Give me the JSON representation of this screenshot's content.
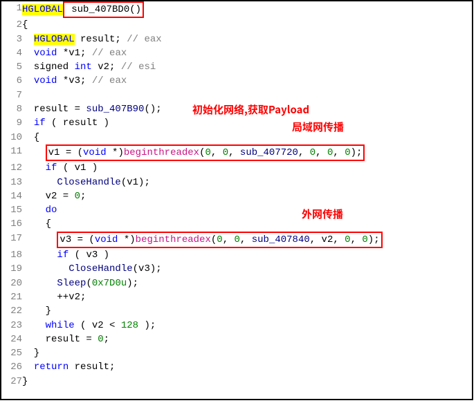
{
  "annotations": {
    "a1": "初始化网络,获取Payload",
    "a2": "局域网传播",
    "a3": "外网传播"
  },
  "lines": {
    "l1_a": "HGLOBAL",
    "l1_b": " sub_407BD0()",
    "l2": "{",
    "l3_a": "  ",
    "l3_b": "HGLOBAL",
    "l3_c": " result; ",
    "l3_d": "// eax",
    "l4_a": "  ",
    "l4_b": "void",
    "l4_c": " *v1; ",
    "l4_d": "// eax",
    "l5_a": "  signed ",
    "l5_b": "int",
    "l5_c": " v2; ",
    "l5_d": "// esi",
    "l6_a": "  ",
    "l6_b": "void",
    "l6_c": " *v3; ",
    "l6_d": "// eax",
    "l7": "",
    "l8_a": "  result = ",
    "l8_b": "sub_407B90",
    "l8_c": "();",
    "l9_a": "  ",
    "l9_b": "if",
    "l9_c": " ( result )",
    "l10": "  {",
    "l11_pre": "    ",
    "l11_a": "v1 = (",
    "l11_b": "void",
    "l11_c": " *)",
    "l11_d": "beginthreadex",
    "l11_e": "(",
    "l11_f": "0",
    "l11_g": ", ",
    "l11_h": "0",
    "l11_i": ", ",
    "l11_j": "sub_407720",
    "l11_k": ", ",
    "l11_l": "0",
    "l11_m": ", ",
    "l11_n": "0",
    "l11_o": ", ",
    "l11_p": "0",
    "l11_q": ");",
    "l12_a": "    ",
    "l12_b": "if",
    "l12_c": " ( v1 )",
    "l13_a": "      ",
    "l13_b": "CloseHandle",
    "l13_c": "(v1);",
    "l14_a": "    v2 = ",
    "l14_b": "0",
    "l14_c": ";",
    "l15_a": "    ",
    "l15_b": "do",
    "l16": "    {",
    "l17_pre": "      ",
    "l17_a": "v3 = (",
    "l17_b": "void",
    "l17_c": " *)",
    "l17_d": "beginthreadex",
    "l17_e": "(",
    "l17_f": "0",
    "l17_g": ", ",
    "l17_h": "0",
    "l17_i": ", ",
    "l17_j": "sub_407840",
    "l17_k": ", v2, ",
    "l17_l": "0",
    "l17_m": ", ",
    "l17_n": "0",
    "l17_o": ");",
    "l18_a": "      ",
    "l18_b": "if",
    "l18_c": " ( v3 )",
    "l19_a": "        ",
    "l19_b": "CloseHandle",
    "l19_c": "(v3);",
    "l20_a": "      ",
    "l20_b": "Sleep",
    "l20_c": "(",
    "l20_d": "0x7D0u",
    "l20_e": ");",
    "l21": "      ++v2;",
    "l22": "    }",
    "l23_a": "    ",
    "l23_b": "while",
    "l23_c": " ( v2 < ",
    "l23_d": "128",
    "l23_e": " );",
    "l24_a": "    result = ",
    "l24_b": "0",
    "l24_c": ";",
    "l25": "  }",
    "l26_a": "  ",
    "l26_b": "return",
    "l26_c": " result;",
    "l27": "}"
  }
}
